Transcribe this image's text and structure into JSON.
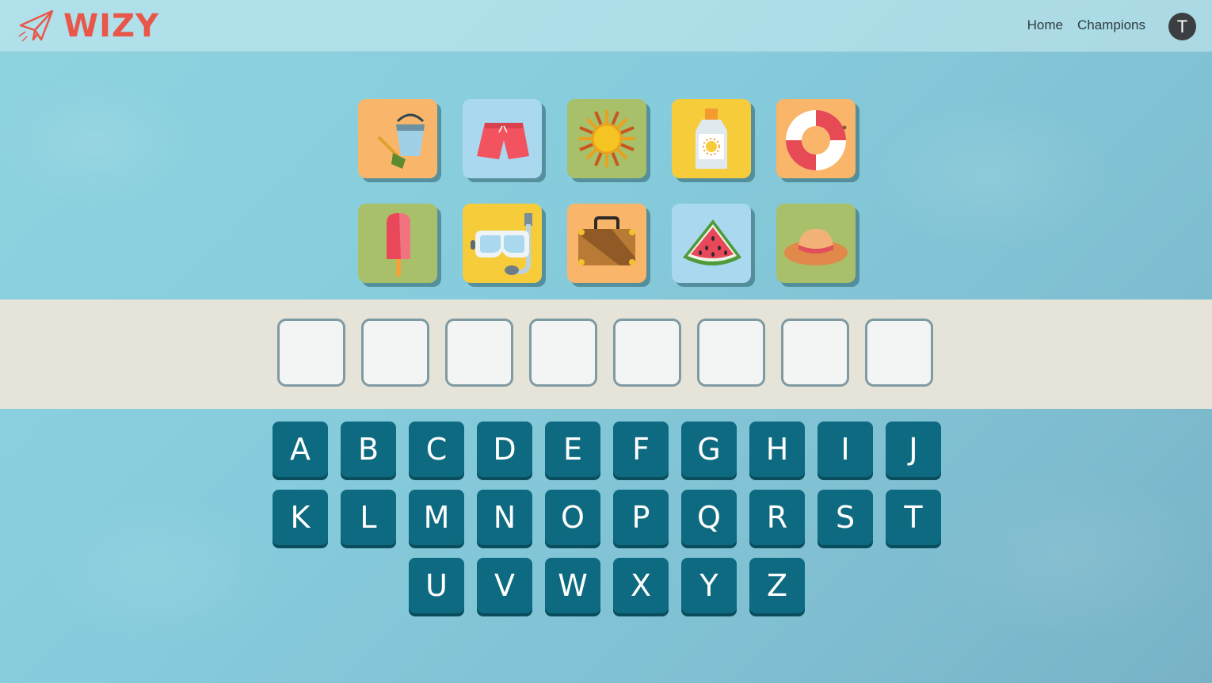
{
  "header": {
    "logo_text": "WIZY",
    "nav": [
      {
        "label": "Home"
      },
      {
        "label": "Champions"
      }
    ],
    "avatar_initial": "T"
  },
  "colors": {
    "logo": "#e8574a",
    "key": "#0d6a80",
    "band": "#e6e4d9",
    "tile_orange": "#f9b66a",
    "tile_blue": "#a9d8ef",
    "tile_green": "#a9c06a",
    "tile_yellow": "#f7cc3a"
  },
  "picture_tiles": [
    {
      "icon": "bucket-spade-icon",
      "bg": "#f9b66a"
    },
    {
      "icon": "swim-shorts-icon",
      "bg": "#a9d8ef"
    },
    {
      "icon": "sun-icon",
      "bg": "#a9c06a"
    },
    {
      "icon": "sunscreen-icon",
      "bg": "#f7cc3a"
    },
    {
      "icon": "life-ring-icon",
      "bg": "#f9b66a"
    },
    {
      "icon": "popsicle-icon",
      "bg": "#a9c06a"
    },
    {
      "icon": "snorkel-mask-icon",
      "bg": "#f7cc3a"
    },
    {
      "icon": "suitcase-icon",
      "bg": "#f9b66a"
    },
    {
      "icon": "watermelon-icon",
      "bg": "#a9d8ef"
    },
    {
      "icon": "sun-hat-icon",
      "bg": "#a9c06a"
    }
  ],
  "answer_slots": 8,
  "keyboard": {
    "rows": [
      [
        "A",
        "B",
        "C",
        "D",
        "E",
        "F",
        "G",
        "H",
        "I",
        "J"
      ],
      [
        "K",
        "L",
        "M",
        "N",
        "O",
        "P",
        "Q",
        "R",
        "S",
        "T"
      ],
      [
        "U",
        "V",
        "W",
        "X",
        "Y",
        "Z"
      ]
    ]
  }
}
